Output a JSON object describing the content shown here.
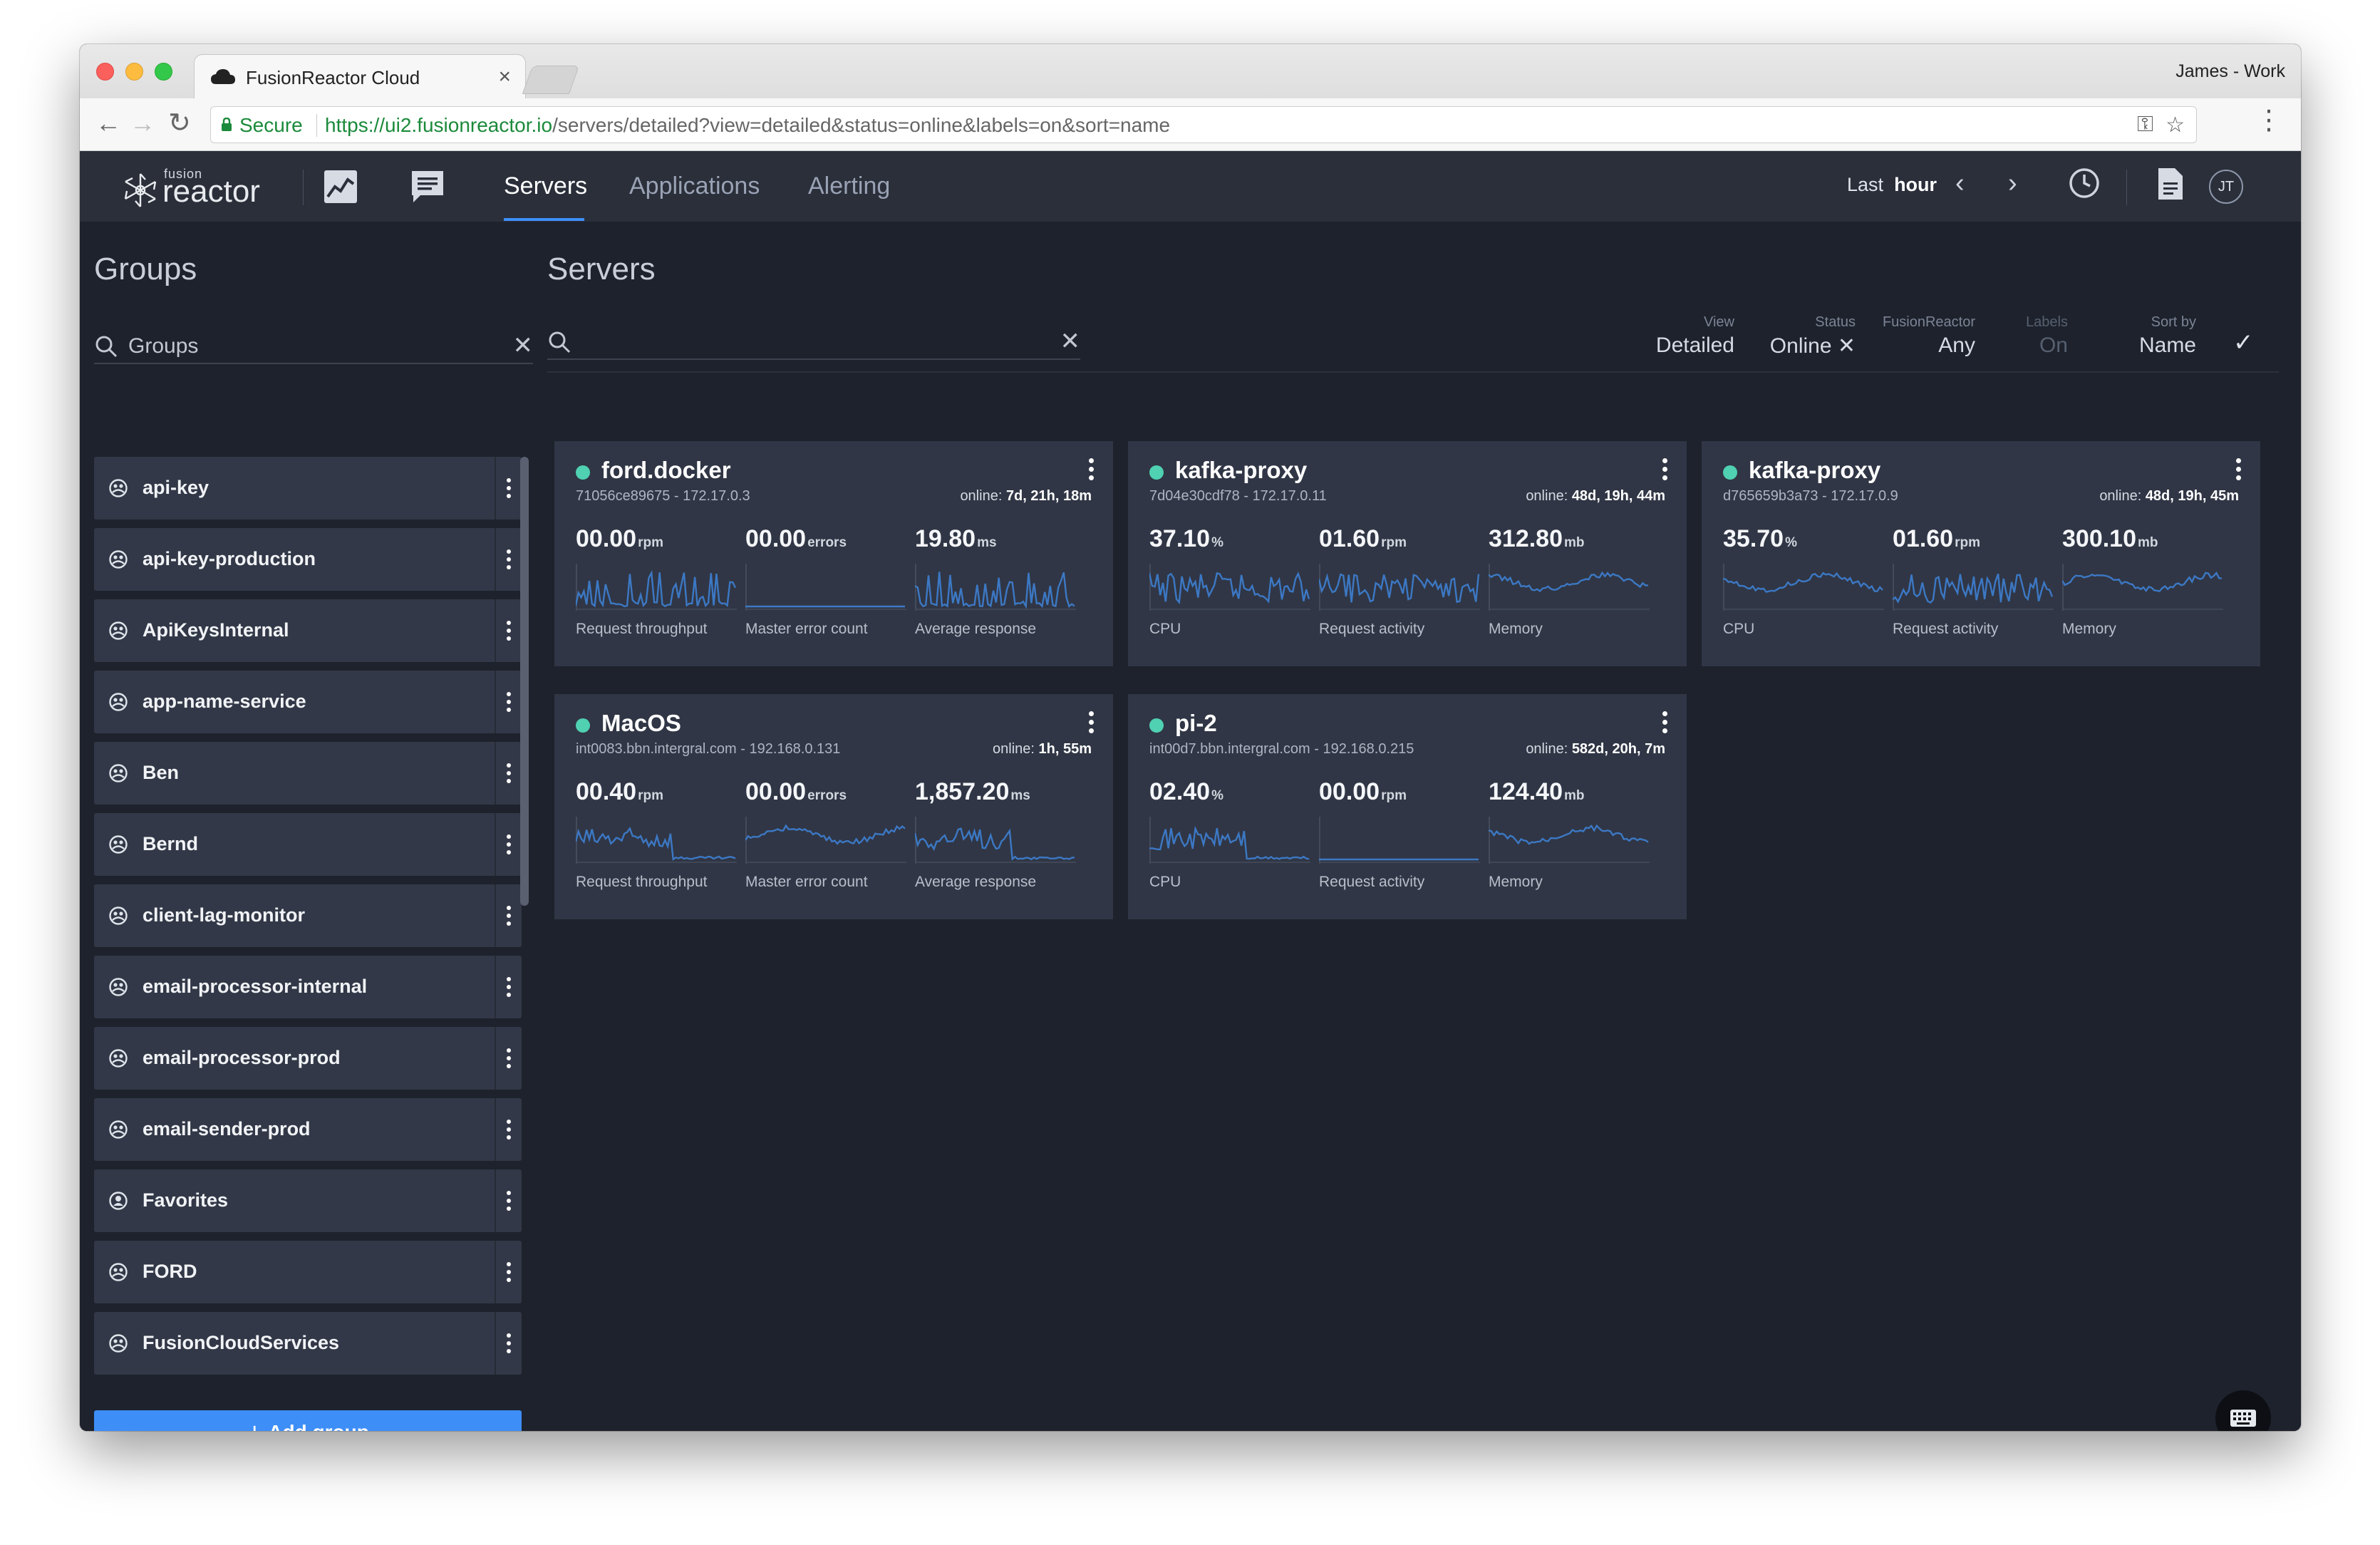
{
  "browser": {
    "tab_title": "FusionReactor Cloud",
    "tab_close": "×",
    "profile": "James - Work",
    "secure_label": "Secure",
    "url_scheme": "https://",
    "url_host": "ui2.fusionreactor.io",
    "url_path": "/servers/detailed?view=detailed&status=online&labels=on&sort=name"
  },
  "app": {
    "logo_small": "fusion",
    "logo_large": "reactor",
    "nav_tabs": [
      "Servers",
      "Applications",
      "Alerting"
    ],
    "active_tab": "Servers",
    "range_prefix": "Last",
    "range_value": "hour",
    "avatar": "JT",
    "accent": "#3e8ef7",
    "status_online": "#4fd1b2"
  },
  "groups": {
    "title": "Groups",
    "search_placeholder": "Groups",
    "add_label": "Add group",
    "items": [
      {
        "label": "api-key",
        "icon": "group-icon"
      },
      {
        "label": "api-key-production",
        "icon": "group-icon"
      },
      {
        "label": "ApiKeysInternal",
        "icon": "group-icon"
      },
      {
        "label": "app-name-service",
        "icon": "group-icon"
      },
      {
        "label": "Ben",
        "icon": "group-icon"
      },
      {
        "label": "Bernd",
        "icon": "group-icon"
      },
      {
        "label": "client-lag-monitor",
        "icon": "group-icon"
      },
      {
        "label": "email-processor-internal",
        "icon": "group-icon"
      },
      {
        "label": "email-processor-prod",
        "icon": "group-icon"
      },
      {
        "label": "email-sender-prod",
        "icon": "group-icon"
      },
      {
        "label": "Favorites",
        "icon": "user-icon"
      },
      {
        "label": "FORD",
        "icon": "group-icon"
      },
      {
        "label": "FusionCloudServices",
        "icon": "group-icon"
      }
    ]
  },
  "servers": {
    "title": "Servers",
    "filters": {
      "view": {
        "label": "View",
        "value": "Detailed"
      },
      "status": {
        "label": "Status",
        "value": "Online ✕"
      },
      "fusionreactor": {
        "label": "FusionReactor",
        "value": "Any"
      },
      "labels": {
        "label": "Labels",
        "value": "On"
      },
      "sort": {
        "label": "Sort by",
        "value": "Name"
      }
    },
    "cards": [
      {
        "name": "ford.docker",
        "sub": "71056ce89675 - 172.17.0.3",
        "online_prefix": "online:",
        "online": "7d, 21h, 18m",
        "metrics": [
          {
            "value": "00.00",
            "unit": "rpm",
            "label": "Request throughput"
          },
          {
            "value": "00.00",
            "unit": "errors",
            "label": "Master error count"
          },
          {
            "value": "19.80",
            "unit": "ms",
            "label": "Average response"
          }
        ]
      },
      {
        "name": "kafka-proxy",
        "sub": "7d04e30cdf78 - 172.17.0.11",
        "online_prefix": "online:",
        "online": "48d, 19h, 44m",
        "metrics": [
          {
            "value": "37.10",
            "unit": "%",
            "label": "CPU"
          },
          {
            "value": "01.60",
            "unit": "rpm",
            "label": "Request activity"
          },
          {
            "value": "312.80",
            "unit": "mb",
            "label": "Memory"
          }
        ]
      },
      {
        "name": "kafka-proxy",
        "sub": "d765659b3a73 - 172.17.0.9",
        "online_prefix": "online:",
        "online": "48d, 19h, 45m",
        "metrics": [
          {
            "value": "35.70",
            "unit": "%",
            "label": "CPU"
          },
          {
            "value": "01.60",
            "unit": "rpm",
            "label": "Request activity"
          },
          {
            "value": "300.10",
            "unit": "mb",
            "label": "Memory"
          }
        ]
      },
      {
        "name": "MacOS",
        "sub": "int0083.bbn.intergral.com - 192.168.0.131",
        "online_prefix": "online:",
        "online": "1h, 55m",
        "metrics": [
          {
            "value": "00.40",
            "unit": "rpm",
            "label": "Request throughput"
          },
          {
            "value": "00.00",
            "unit": "errors",
            "label": "Master error count"
          },
          {
            "value": "1,857.20",
            "unit": "ms",
            "label": "Average response"
          }
        ]
      },
      {
        "name": "pi-2",
        "sub": "int00d7.bbn.intergral.com - 192.168.0.215",
        "online_prefix": "online:",
        "online": "582d, 20h, 7m",
        "metrics": [
          {
            "value": "02.40",
            "unit": "%",
            "label": "CPU"
          },
          {
            "value": "00.00",
            "unit": "rpm",
            "label": "Request activity"
          },
          {
            "value": "124.40",
            "unit": "mb",
            "label": "Memory"
          }
        ]
      }
    ]
  }
}
